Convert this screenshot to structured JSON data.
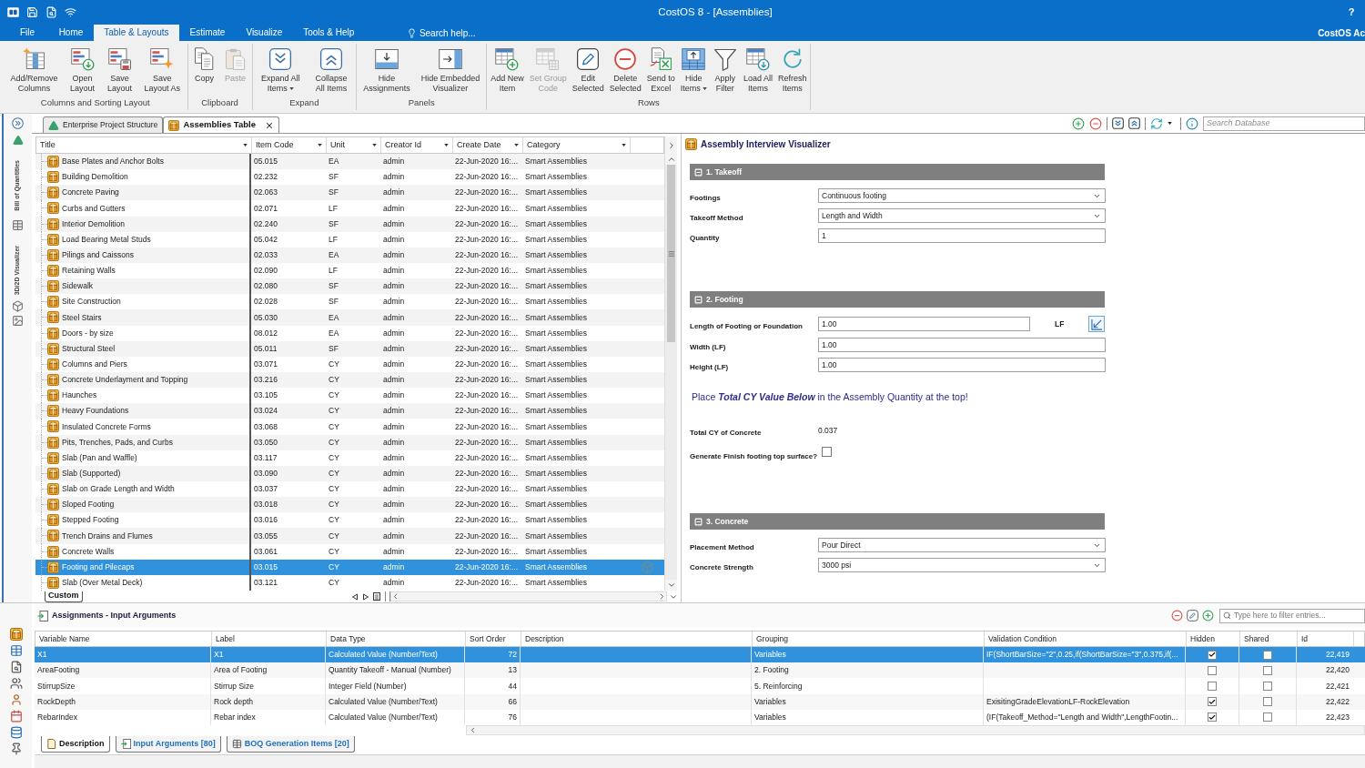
{
  "window": {
    "title": "CostOS 8 - [Assemblies]",
    "help": "?",
    "account": "CostOS Ac"
  },
  "ribbon_tabs": [
    {
      "label": "File",
      "selected": false
    },
    {
      "label": "Home",
      "selected": false
    },
    {
      "label": "Table & Layouts",
      "selected": true
    },
    {
      "label": "Estimate",
      "selected": false
    },
    {
      "label": "Visualize",
      "selected": false
    },
    {
      "label": "Tools & Help",
      "selected": false
    }
  ],
  "search_help": "Search help...",
  "ribbon_groups": [
    {
      "label": "Columns and Sorting Layout",
      "buttons": [
        {
          "label": "Add/Remove\nColumns",
          "disabled": false,
          "dropdown": false
        },
        {
          "label": "Open\nLayout",
          "disabled": false,
          "dropdown": false
        },
        {
          "label": "Save\nLayout",
          "disabled": false,
          "dropdown": false
        },
        {
          "label": "Save\nLayout As",
          "disabled": false,
          "dropdown": false
        }
      ]
    },
    {
      "label": "Clipboard",
      "buttons": [
        {
          "label": "Copy",
          "disabled": false,
          "dropdown": false
        },
        {
          "label": "Paste",
          "disabled": true,
          "dropdown": false
        }
      ]
    },
    {
      "label": "Expand",
      "buttons": [
        {
          "label": "Expand All\nItems",
          "disabled": false,
          "dropdown": true
        },
        {
          "label": "Collapse\nAll Items",
          "disabled": false,
          "dropdown": false
        }
      ]
    },
    {
      "label": "Panels",
      "buttons": [
        {
          "label": "Hide\nAssignments",
          "disabled": false,
          "dropdown": false
        },
        {
          "label": "Hide Embedded\nVisualizer",
          "disabled": false,
          "dropdown": false
        }
      ]
    },
    {
      "label": "Rows",
      "buttons": [
        {
          "label": "Add New\nItem",
          "disabled": false,
          "dropdown": false
        },
        {
          "label": "Set Group\nCode",
          "disabled": true,
          "dropdown": false
        },
        {
          "label": "Edit\nSelected",
          "disabled": false,
          "dropdown": false
        },
        {
          "label": "Delete\nSelected",
          "disabled": false,
          "dropdown": false
        },
        {
          "label": "Send to\nExcel",
          "disabled": false,
          "dropdown": false
        },
        {
          "label": "Hide\nItems",
          "disabled": false,
          "dropdown": true
        },
        {
          "label": "Apply\nFilter",
          "disabled": false,
          "dropdown": false
        },
        {
          "label": "Load All\nItems",
          "disabled": false,
          "dropdown": false
        },
        {
          "label": "Refresh\nItems",
          "disabled": false,
          "dropdown": false
        }
      ]
    }
  ],
  "side_panel_tabs": [
    "Bill of Quantities",
    "3D/2D Visualizer"
  ],
  "document_tabs": [
    {
      "label": "Enterprise Project Structure",
      "selected": false,
      "closable": false
    },
    {
      "label": "Assemblies Table",
      "selected": true,
      "closable": true
    }
  ],
  "database_search": {
    "placeholder": "Search Database"
  },
  "assemblies_table": {
    "columns": [
      "Title",
      "Item Code",
      "Unit",
      "Creator Id",
      "Create Date",
      "Category"
    ],
    "rows": [
      {
        "title": "Base Plates and Anchor Bolts",
        "item_code": "05.015",
        "unit": "EA",
        "creator_id": "admin",
        "create_date": "22-Jun-2020 16:...",
        "category": "Smart Assemblies",
        "selected": false
      },
      {
        "title": "Building Demolition",
        "item_code": "02.232",
        "unit": "SF",
        "creator_id": "admin",
        "create_date": "22-Jun-2020 16:...",
        "category": "Smart Assemblies",
        "selected": false
      },
      {
        "title": "Concrete Paving",
        "item_code": "02.063",
        "unit": "SF",
        "creator_id": "admin",
        "create_date": "22-Jun-2020 16:...",
        "category": "Smart Assemblies",
        "selected": false
      },
      {
        "title": "Curbs and Gutters",
        "item_code": "02.071",
        "unit": "LF",
        "creator_id": "admin",
        "create_date": "22-Jun-2020 16:...",
        "category": "Smart Assemblies",
        "selected": false
      },
      {
        "title": "Interior Demolition",
        "item_code": "02.240",
        "unit": "SF",
        "creator_id": "admin",
        "create_date": "22-Jun-2020 16:...",
        "category": "Smart Assemblies",
        "selected": false
      },
      {
        "title": "Load Bearing Metal Studs",
        "item_code": "05.042",
        "unit": "LF",
        "creator_id": "admin",
        "create_date": "22-Jun-2020 16:...",
        "category": "Smart Assemblies",
        "selected": false
      },
      {
        "title": "Pilings and Caissons",
        "item_code": "02.033",
        "unit": "EA",
        "creator_id": "admin",
        "create_date": "22-Jun-2020 16:...",
        "category": "Smart Assemblies",
        "selected": false
      },
      {
        "title": "Retaining Walls",
        "item_code": "02.090",
        "unit": "LF",
        "creator_id": "admin",
        "create_date": "22-Jun-2020 16:...",
        "category": "Smart Assemblies",
        "selected": false
      },
      {
        "title": "Sidewalk",
        "item_code": "02.080",
        "unit": "SF",
        "creator_id": "admin",
        "create_date": "22-Jun-2020 16:...",
        "category": "Smart Assemblies",
        "selected": false
      },
      {
        "title": "Site Construction",
        "item_code": "02.028",
        "unit": "SF",
        "creator_id": "admin",
        "create_date": "22-Jun-2020 16:...",
        "category": "Smart Assemblies",
        "selected": false
      },
      {
        "title": "Steel Stairs",
        "item_code": "05.030",
        "unit": "EA",
        "creator_id": "admin",
        "create_date": "22-Jun-2020 16:...",
        "category": "Smart Assemblies",
        "selected": false
      },
      {
        "title": "Doors - by size",
        "item_code": "08.012",
        "unit": "EA",
        "creator_id": "admin",
        "create_date": "22-Jun-2020 16:...",
        "category": "Smart Assemblies",
        "selected": false
      },
      {
        "title": "Structural Steel",
        "item_code": "05.011",
        "unit": "SF",
        "creator_id": "admin",
        "create_date": "22-Jun-2020 16:...",
        "category": "Smart Assemblies",
        "selected": false
      },
      {
        "title": "Columns and Piers",
        "item_code": "03.071",
        "unit": "CY",
        "creator_id": "admin",
        "create_date": "22-Jun-2020 16:...",
        "category": "Smart Assemblies",
        "selected": false
      },
      {
        "title": "Concrete Underlayment and Topping",
        "item_code": "03.216",
        "unit": "CY",
        "creator_id": "admin",
        "create_date": "22-Jun-2020 16:...",
        "category": "Smart Assemblies",
        "selected": false
      },
      {
        "title": "Haunches",
        "item_code": "03.105",
        "unit": "CY",
        "creator_id": "admin",
        "create_date": "22-Jun-2020 16:...",
        "category": "Smart Assemblies",
        "selected": false
      },
      {
        "title": "Heavy Foundations",
        "item_code": "03.024",
        "unit": "CY",
        "creator_id": "admin",
        "create_date": "22-Jun-2020 16:...",
        "category": "Smart Assemblies",
        "selected": false
      },
      {
        "title": "Insulated Concrete Forms",
        "item_code": "03.068",
        "unit": "CY",
        "creator_id": "admin",
        "create_date": "22-Jun-2020 16:...",
        "category": "Smart Assemblies",
        "selected": false
      },
      {
        "title": "Pits, Trenches, Pads, and Curbs",
        "item_code": "03.050",
        "unit": "CY",
        "creator_id": "admin",
        "create_date": "22-Jun-2020 16:...",
        "category": "Smart Assemblies",
        "selected": false
      },
      {
        "title": "Slab (Pan and Waffle)",
        "item_code": "03.117",
        "unit": "CY",
        "creator_id": "admin",
        "create_date": "22-Jun-2020 16:...",
        "category": "Smart Assemblies",
        "selected": false
      },
      {
        "title": "Slab (Supported)",
        "item_code": "03.090",
        "unit": "CY",
        "creator_id": "admin",
        "create_date": "22-Jun-2020 16:...",
        "category": "Smart Assemblies",
        "selected": false
      },
      {
        "title": "Slab on Grade Length and Width",
        "item_code": "03.037",
        "unit": "CY",
        "creator_id": "admin",
        "create_date": "22-Jun-2020 16:...",
        "category": "Smart Assemblies",
        "selected": false
      },
      {
        "title": "Sloped Footing",
        "item_code": "03.018",
        "unit": "CY",
        "creator_id": "admin",
        "create_date": "22-Jun-2020 16:...",
        "category": "Smart Assemblies",
        "selected": false
      },
      {
        "title": "Stepped Footing",
        "item_code": "03.016",
        "unit": "CY",
        "creator_id": "admin",
        "create_date": "22-Jun-2020 16:...",
        "category": "Smart Assemblies",
        "selected": false
      },
      {
        "title": "Trench Drains and Flumes",
        "item_code": "03.055",
        "unit": "CY",
        "creator_id": "admin",
        "create_date": "22-Jun-2020 16:...",
        "category": "Smart Assemblies",
        "selected": false
      },
      {
        "title": "Concrete Walls",
        "item_code": "03.061",
        "unit": "CY",
        "creator_id": "admin",
        "create_date": "22-Jun-2020 16:...",
        "category": "Smart Assemblies",
        "selected": false
      },
      {
        "title": "Footing and Pilecaps",
        "item_code": "03.015",
        "unit": "CY",
        "creator_id": "admin",
        "create_date": "22-Jun-2020 16:...",
        "category": "Smart Assemblies",
        "selected": true
      },
      {
        "title": "Slab (Over Metal Deck)",
        "item_code": "03.121",
        "unit": "CY",
        "creator_id": "admin",
        "create_date": "22-Jun-2020 16:...",
        "category": "Smart Assemblies",
        "selected": false
      }
    ],
    "sheet_tabs": [
      {
        "label": "Custom",
        "selected": true
      }
    ]
  },
  "visualizer": {
    "title": "Assembly Interview Visualizer",
    "sections": [
      {
        "title": "1. Takeoff",
        "expanded": true,
        "fields": [
          {
            "kind": "select",
            "label": "Footings",
            "value": "Continuous footing"
          },
          {
            "kind": "select",
            "label": "Takeoff Method",
            "value": "Length and Width"
          },
          {
            "kind": "input",
            "label": "Quantity",
            "value": "1"
          }
        ]
      },
      {
        "title": "2. Footing",
        "expanded": true,
        "fields": [
          {
            "kind": "input_unit",
            "label": "Length of Footing or Foundation",
            "value": "1.00",
            "unit": "LF"
          },
          {
            "kind": "input",
            "label": "Width (LF)",
            "value": "1.00"
          },
          {
            "kind": "input",
            "label": "Height (LF)",
            "value": "1.00"
          },
          {
            "kind": "note",
            "text": "Place **Total CY Value Below** in the Assembly Quantity at the top!"
          },
          {
            "kind": "readout",
            "label": "Total CY of Concrete",
            "value": "0.037"
          },
          {
            "kind": "checkbox",
            "label": "Generate Finish footing top surface?",
            "checked": false
          }
        ]
      },
      {
        "title": "3. Concrete",
        "expanded": true,
        "fields": [
          {
            "kind": "select",
            "label": "Placement Method",
            "value": "Pour Direct"
          },
          {
            "kind": "select",
            "label": "Concrete Strength",
            "value": "3000 psi"
          }
        ]
      }
    ]
  },
  "assignments": {
    "title": "Assignments - Input Arguments",
    "filter": {
      "placeholder": "Type here to filter entries..."
    },
    "columns": [
      "Variable Name",
      "Label",
      "Data Type",
      "Sort Order",
      "Description",
      "Grouping",
      "Validation Condition",
      "Hidden",
      "Shared",
      "Id"
    ],
    "rows": [
      {
        "variable_name": "X1",
        "label": "X1",
        "data_type": "Calculated Value (Number/Text)",
        "sort_order": "72",
        "grouping": "Variables",
        "validation_condition": "IF(ShortBarSize=\"2\",0.25,if(ShortBarSize=\"3\",0.375,if(...",
        "hidden": true,
        "shared": false,
        "id": "22,419",
        "selected": true
      },
      {
        "variable_name": "AreaFooting",
        "label": "Area of Footing",
        "data_type": "Quantity Takeoff - Manual (Number)",
        "sort_order": "13",
        "grouping": "2. Footing",
        "hidden": false,
        "shared": false,
        "id": "22,420",
        "selected": false
      },
      {
        "variable_name": "StirrupSize",
        "label": "Stirrup Size",
        "data_type": "Integer Field (Number)",
        "sort_order": "44",
        "grouping": "5. Reinforcing",
        "hidden": false,
        "shared": false,
        "id": "22,421",
        "selected": false
      },
      {
        "variable_name": "RockDepth",
        "label": "Rock depth",
        "data_type": "Calculated Value (Number/Text)",
        "sort_order": "66",
        "grouping": "Variables",
        "validation_condition": "ExisitingGradeElevationLF-RockElevation",
        "hidden": true,
        "shared": false,
        "id": "22,422",
        "selected": false
      },
      {
        "variable_name": "RebarIndex",
        "label": "Rebar index",
        "data_type": "Calculated Value (Number/Text)",
        "sort_order": "76",
        "grouping": "Variables",
        "validation_condition": "(IF(Takeoff_Method=\"Length and Width\",LengthFootin...",
        "hidden": true,
        "shared": false,
        "id": "22,423",
        "selected": false
      }
    ],
    "tabs": [
      {
        "label": "Description",
        "selected": true
      },
      {
        "label": "Input Arguments [80]",
        "selected": false
      },
      {
        "label": "BOQ Generation Items [20]",
        "selected": false
      }
    ]
  }
}
